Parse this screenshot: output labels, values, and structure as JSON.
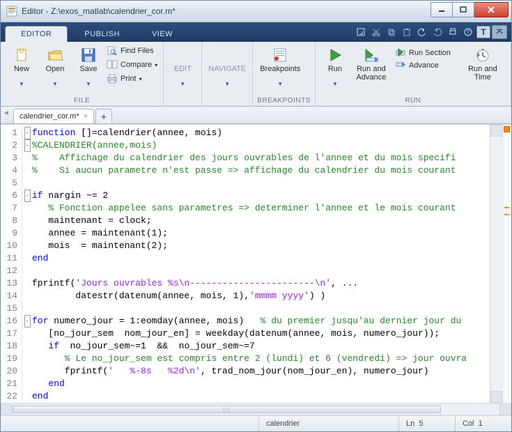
{
  "window": {
    "title": "Editor - Z:\\exos_matlab\\calendrier_cor.m*"
  },
  "ribbon": {
    "tabs": [
      "EDITOR",
      "PUBLISH",
      "VIEW"
    ],
    "active_index": 0
  },
  "toolstrip": {
    "file": {
      "label": "FILE",
      "new": "New",
      "open": "Open",
      "save": "Save",
      "find_files": "Find Files",
      "compare": "Compare",
      "print": "Print"
    },
    "edit": {
      "label": "",
      "btn": "EDIT"
    },
    "navigate": {
      "label": "",
      "btn": "NAVIGATE"
    },
    "breakpoints": {
      "label": "BREAKPOINTS",
      "btn": "Breakpoints"
    },
    "run": {
      "label": "RUN",
      "run": "Run",
      "run_and_advance": "Run and\nAdvance",
      "run_section": "Run Section",
      "advance": "Advance",
      "run_and_time": "Run and\nTime"
    }
  },
  "file_tabs": {
    "active": "calendrier_cor.m*"
  },
  "code": {
    "lines_count": 22,
    "lines": {
      "l1": {
        "pre": "",
        "kw": "function",
        "post": " []=calendrier(annee, mois)"
      },
      "l2": {
        "cm": "%CALENDRIER(annee,mois)"
      },
      "l3": {
        "cm": "%    Affichage du calendrier des jours ouvrables de l'annee et du mois specifi"
      },
      "l4": {
        "cm": "%    Si aucun parametre n'est passe => affichage du calendrier du mois courant"
      },
      "l5": {
        "plain": ""
      },
      "l6": {
        "kw": "if",
        "post": " nargin ~= 2"
      },
      "l7": {
        "cm": "   % Fonction appelee sans parametres => determiner l'annee et le mois courant"
      },
      "l8": {
        "plain": "   maintenant = clock;"
      },
      "l9": {
        "plain": "   annee = maintenant(1);"
      },
      "l10": {
        "plain": "   mois  = maintenant(2);"
      },
      "l11": {
        "kw": "end"
      },
      "l12": {
        "plain": ""
      },
      "l13": {
        "pre": "fprintf(",
        "str": "'Jours ouvrables %s\\n-----------------------\\n'",
        "mid": ", ",
        "kw": "...",
        "post": ""
      },
      "l14": {
        "pre": "        datestr(datenum(annee, mois, 1),",
        "str": "'mmmm yyyy'",
        "post": ") )"
      },
      "l15": {
        "plain": ""
      },
      "l16": {
        "kw": "for",
        "post": " numero_jour = 1:eomday(annee, mois)   ",
        "cm": "% du premier jusqu'au dernier jour du"
      },
      "l17": {
        "plain": "   [no_jour_sem  nom_jour_en] = weekday(datenum(annee, mois, numero_jour));"
      },
      "l18": {
        "pre": "   ",
        "kw": "if",
        "post": "  no_jour_sem~=1  &&  no_jour_sem~=7"
      },
      "l19": {
        "cm": "      % Le no_jour_sem est compris entre 2 (lundi) et 6 (vendredi) => jour ouvra"
      },
      "l20": {
        "pre": "      fprintf(",
        "str": "'   %-8s   %2d\\n'",
        "post": ", trad_nom_jour(nom_jour_en), numero_jour)"
      },
      "l21": {
        "pre": "   ",
        "kw": "end"
      },
      "l22": {
        "kw": "end"
      }
    }
  },
  "status": {
    "fn": "calendrier",
    "line_lbl": "Ln",
    "line": "5",
    "col_lbl": "Col",
    "col": "1"
  }
}
